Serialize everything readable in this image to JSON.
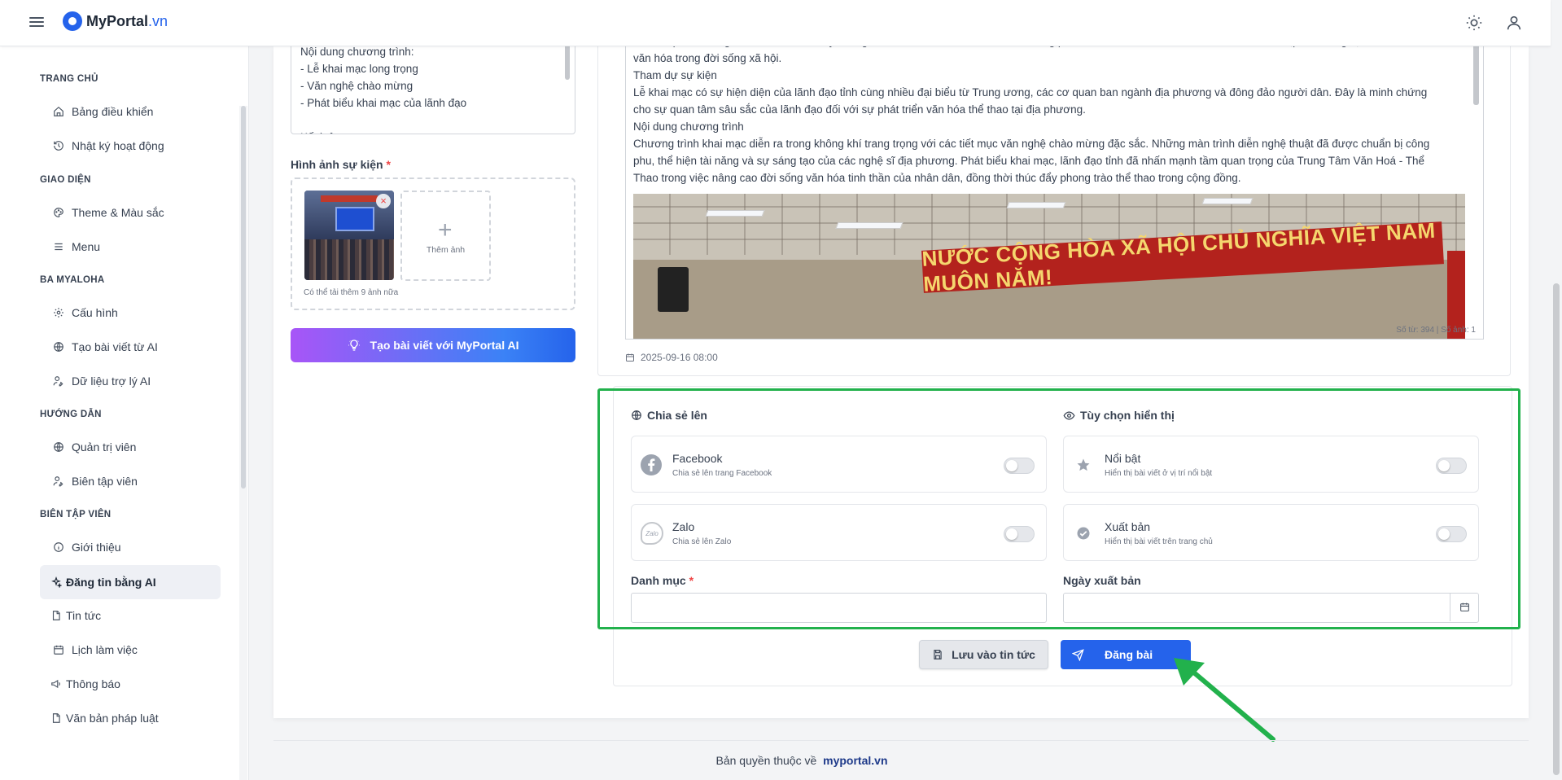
{
  "header": {
    "logo_main": "MyPortal",
    "logo_suffix": ".vn"
  },
  "sidebar": {
    "sections": [
      {
        "title": "TRANG CHỦ",
        "items": [
          {
            "label": "Bảng điều khiển",
            "icon": "home-icon"
          },
          {
            "label": "Nhật ký hoạt động",
            "icon": "history-icon"
          }
        ]
      },
      {
        "title": "GIAO DIỆN",
        "items": [
          {
            "label": "Theme & Màu sắc",
            "icon": "palette-icon"
          },
          {
            "label": "Menu",
            "icon": "menu-icon"
          }
        ]
      },
      {
        "title": "BA MYALOHA",
        "items": [
          {
            "label": "Cấu hình",
            "icon": "gear-icon"
          },
          {
            "label": "Tạo bài viết từ AI",
            "icon": "globe-icon"
          },
          {
            "label": "Dữ liệu trợ lý AI",
            "icon": "user-edit-icon"
          }
        ]
      },
      {
        "title": "HƯỚNG DẪN",
        "items": [
          {
            "label": "Quản trị viên",
            "icon": "globe-icon"
          },
          {
            "label": "Biên tập viên",
            "icon": "user-edit-icon"
          }
        ]
      },
      {
        "title": "BIÊN TẬP VIÊN",
        "items": [
          {
            "label": "Giới thiệu",
            "icon": "info-icon"
          },
          {
            "label": "Đăng tin bằng AI",
            "icon": "sparkle-icon",
            "active": true
          },
          {
            "label": "Tin tức",
            "icon": "file-icon"
          },
          {
            "label": "Lịch làm việc",
            "icon": "calendar-icon"
          },
          {
            "label": "Thông báo",
            "icon": "megaphone-icon"
          },
          {
            "label": "Văn bản pháp luật",
            "icon": "document-icon"
          }
        ]
      }
    ]
  },
  "form": {
    "program_text": "Nội dung chương trình:\n- Lễ khai mạc long trọng\n- Văn nghệ chào mừng\n- Phát biểu khai mạc của lãnh đạo\n\nKết luận",
    "images_label": "Hình ảnh sự kiện",
    "required_mark": "*",
    "add_image_label": "Thêm ảnh",
    "image_hint": "Có thể tải thêm 9 ảnh nữa",
    "ai_button": "Tạo bài viết với MyPortal AI"
  },
  "preview": {
    "lines": [
      "các cơ quan ban ngành. Lễ khai mạc này không chỉ đánh dấu một bước tiến mới trong phát triển văn hóa thể thao của tỉnh mà còn là dịp để khẳng định vai trò của",
      "văn hóa trong đời sống xã hội.",
      "Tham dự sự kiện",
      "Lễ khai mạc có sự hiện diện của lãnh đạo tỉnh cùng nhiều đại biểu từ Trung ương, các cơ quan ban ngành địa phương và đông đảo người dân. Đây là minh chứng",
      "cho sự quan tâm sâu sắc của lãnh đạo đối với sự phát triển văn hóa thể thao tại địa phương.",
      "Nội dung chương trình",
      "Chương trình khai mạc diễn ra trong không khí trang trọng với các tiết mục văn nghệ chào mừng đặc sắc. Những màn trình diễn nghệ thuật đã được chuẩn bị công",
      "phu, thể hiện tài năng và sự sáng tạo của các nghệ sĩ địa phương. Phát biểu khai mạc, lãnh đạo tỉnh đã nhấn mạnh tầm quan trọng của Trung Tâm Văn Hoá - Thể",
      "Thao trong việc nâng cao đời sống văn hóa tinh thần của nhân dân, đồng thời thúc đẩy phong trào thể thao trong cộng đồng."
    ],
    "banner_text": "NƯỚC CỘNG HÒA XÃ HỘI CHỦ NGHĨA VIỆT NAM MUÔN NĂM!",
    "word_count": "Số từ: 394 | Số ảnh: 1",
    "datetime": "2025-09-16 08:00"
  },
  "options": {
    "share_title": "Chia sẻ lên",
    "display_title": "Tùy chọn hiển thị",
    "facebook_name": "Facebook",
    "facebook_desc": "Chia sẻ lên trang Facebook",
    "zalo_name": "Zalo",
    "zalo_desc": "Chia sẻ lên Zalo",
    "zalo_logo": "Zalo",
    "featured_name": "Nổi bật",
    "featured_desc": "Hiển thị bài viết ở vị trí nổi bật",
    "publish_name": "Xuất bản",
    "publish_desc": "Hiển thị bài viết trên trang chủ",
    "category_label": "Danh mục",
    "category_value": "",
    "publish_date_label": "Ngày xuất bản",
    "publish_date_value": ""
  },
  "actions": {
    "save_label": "Lưu vào tin tức",
    "post_label": "Đăng bài"
  },
  "footer": {
    "copyright_prefix": "Bản quyền thuộc về",
    "site_link": "myportal.vn"
  },
  "colors": {
    "accent": "#2563eb",
    "highlight_box": "#22b14c",
    "required": "#ef4444"
  }
}
